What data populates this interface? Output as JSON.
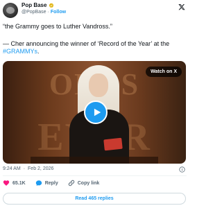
{
  "header": {
    "display_name": "Pop Base",
    "handle": "@PopBase",
    "separator": "·",
    "follow_label": "Follow"
  },
  "tweet": {
    "line1": "“the Grammy goes to Luther Vandross.”",
    "line2_prefix": "— Cher announcing the winner of ‘Record of the Year’ at the ",
    "hashtag": "#GRAMMYs",
    "line2_suffix": "."
  },
  "video": {
    "watch_on_label": "Watch on X",
    "background_letters_top": "ORDS",
    "background_letters_bottom": "EYER"
  },
  "meta": {
    "time": "9:24 AM",
    "separator": "·",
    "date": "Feb 2, 2026"
  },
  "actions": {
    "like_count": "65.1K",
    "reply_label": "Reply",
    "copy_label": "Copy link"
  },
  "footer": {
    "read_replies_label": "Read 465 replies"
  },
  "colors": {
    "accent": "#1d9bf0",
    "like": "#f91880",
    "text": "#0f1419",
    "muted": "#536471"
  }
}
